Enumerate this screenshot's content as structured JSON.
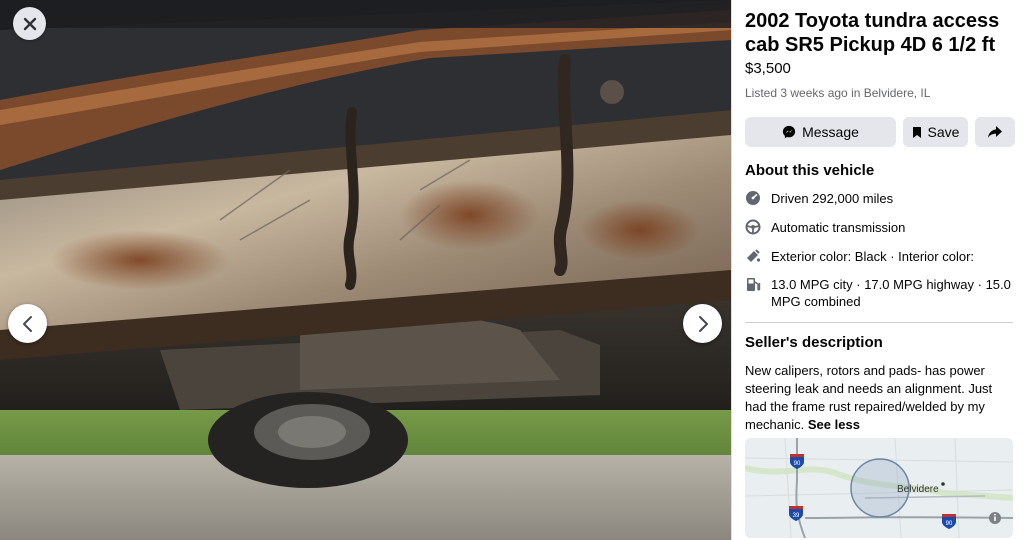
{
  "viewer": {
    "close_icon": "close-icon",
    "prev_icon": "chevron-left-icon",
    "next_icon": "chevron-right-icon"
  },
  "listing": {
    "title": "2002 Toyota tundra access cab SR5 Pickup 4D 6 1/2 ft",
    "price": "$3,500",
    "listed_info": "Listed 3 weeks ago in Belvidere, IL"
  },
  "actions": {
    "message_label": "Message",
    "save_label": "Save",
    "share_icon": "share-icon"
  },
  "about": {
    "heading": "About this vehicle",
    "items": [
      {
        "icon": "speedometer-icon",
        "text": "Driven 292,000 miles"
      },
      {
        "icon": "steering-wheel-icon",
        "text": "Automatic transmission"
      },
      {
        "icon": "paint-icon",
        "text": "Exterior color: Black · Interior color:"
      },
      {
        "icon": "fuel-pump-icon",
        "text": "13.0 MPG city · 17.0 MPG highway · 15.0 MPG combined"
      }
    ]
  },
  "seller": {
    "heading": "Seller's description",
    "description": "New calipers, rotors and pads- has power steering leak and needs an alignment.  Just had the frame rust repaired/welded by my mechanic.",
    "see_less": "See less"
  },
  "map": {
    "city_label": "Belvidere",
    "highway_90a": "90",
    "highway_39": "39",
    "highway_90b": "90",
    "info_icon": "info-icon"
  },
  "colors": {
    "button_bg": "#e4e6eb",
    "secondary_text": "#65676b",
    "divider": "#ced0d4"
  }
}
